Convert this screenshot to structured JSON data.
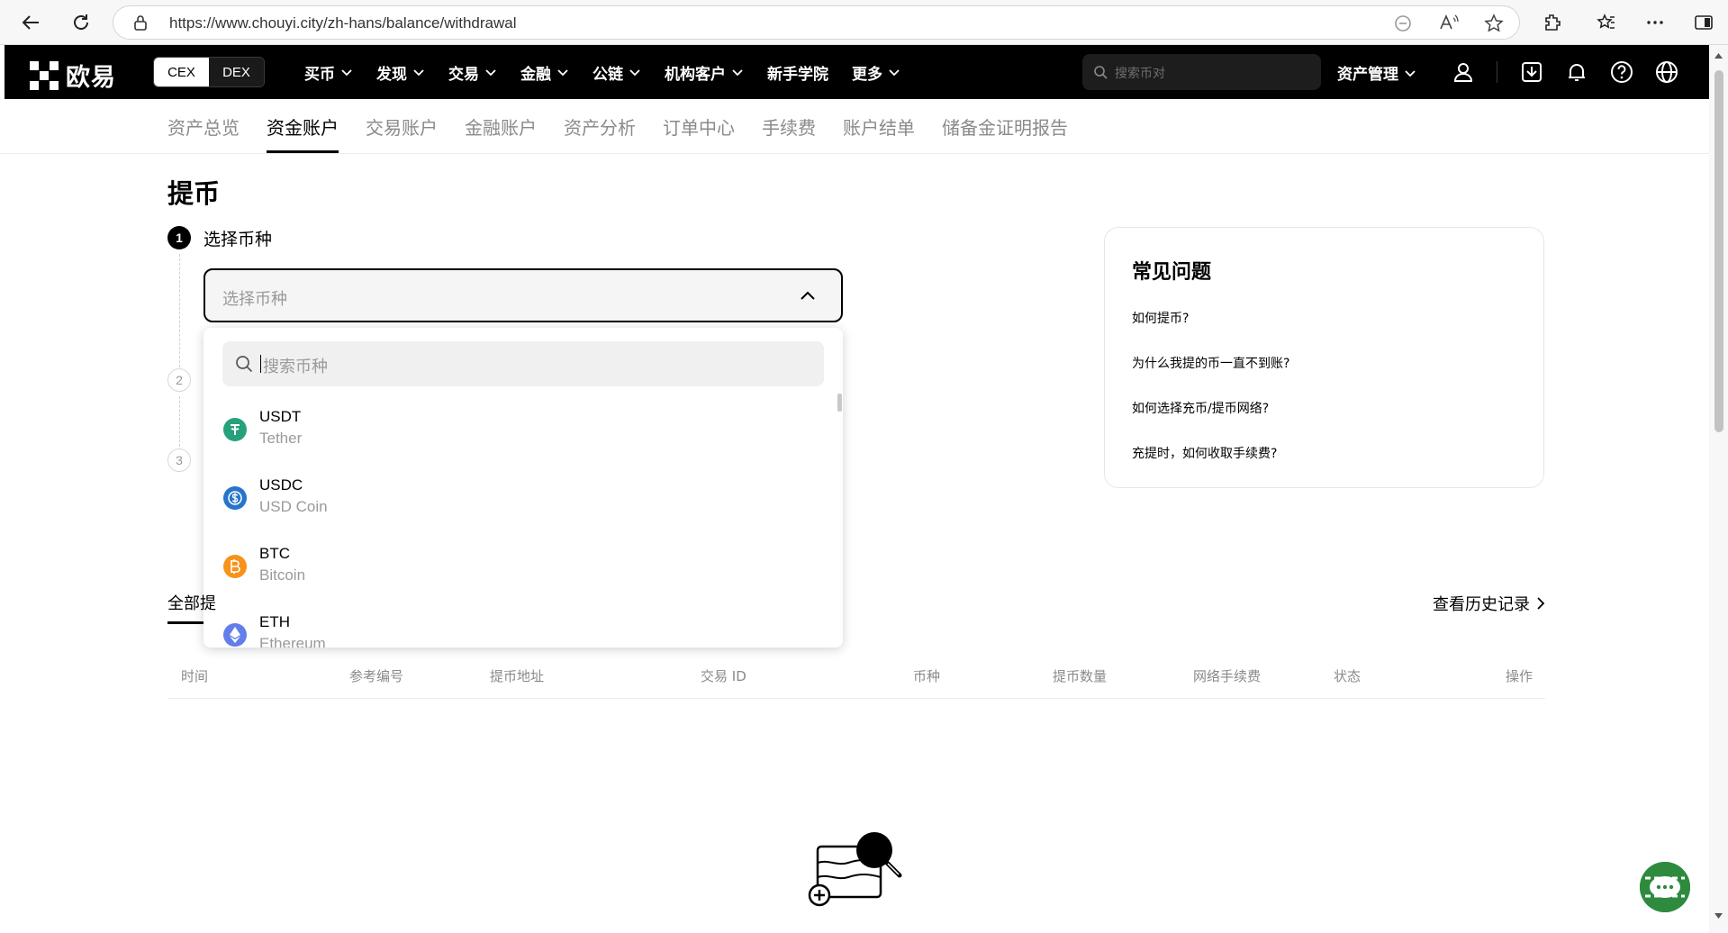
{
  "browser": {
    "url": "https://www.chouyi.city/zh-hans/balance/withdrawal"
  },
  "header": {
    "logo": "欧易",
    "segments": [
      "CEX",
      "DEX"
    ],
    "menu": [
      "买币",
      "发现",
      "交易",
      "金融",
      "公链",
      "机构客户",
      "新手学院",
      "更多"
    ],
    "search_placeholder": "搜索币对",
    "assets_menu": "资产管理"
  },
  "subnav": {
    "tabs": [
      "资产总览",
      "资金账户",
      "交易账户",
      "金融账户",
      "资产分析",
      "订单中心",
      "手续费",
      "账户结单",
      "储备金证明报告"
    ],
    "active": "资金账户"
  },
  "page": {
    "title": "提币",
    "steps": [
      {
        "num": "1",
        "label": "选择币种"
      },
      {
        "num": "2",
        "label": ""
      },
      {
        "num": "3",
        "label": ""
      }
    ],
    "select_placeholder": "选择币种",
    "dropdown": {
      "search_placeholder": "搜索币种",
      "coins": [
        {
          "symbol": "USDT",
          "name": "Tether",
          "color": "#26a17b"
        },
        {
          "symbol": "USDC",
          "name": "USD Coin",
          "color": "#2775ca"
        },
        {
          "symbol": "BTC",
          "name": "Bitcoin",
          "color": "#f7931a"
        },
        {
          "symbol": "ETH",
          "name": "Ethereum",
          "color": "#627eea"
        }
      ]
    }
  },
  "faq": {
    "title": "常见问题",
    "questions": [
      "如何提币?",
      "为什么我提的币一直不到账?",
      "如何选择充币/提币网络?",
      "充提时，如何收取手续费?"
    ]
  },
  "records": {
    "tab": "全部提",
    "history_link": "查看历史记录",
    "columns": [
      "时间",
      "参考编号",
      "提币地址",
      "交易 ID",
      "币种",
      "提币数量",
      "网络手续费",
      "状态",
      "操作"
    ]
  }
}
